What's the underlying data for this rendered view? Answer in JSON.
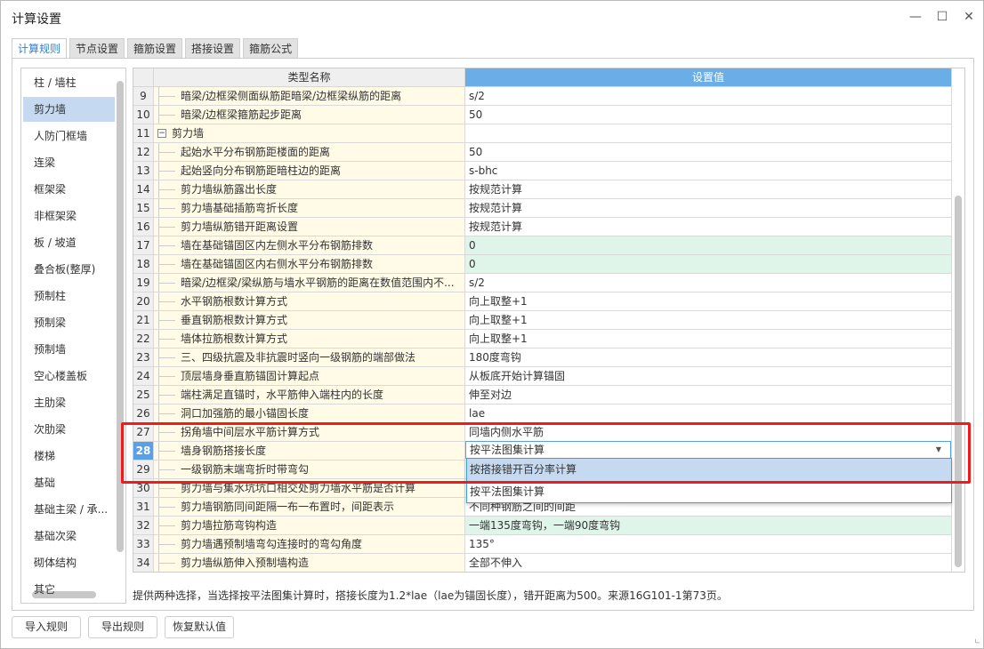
{
  "window": {
    "title": "计算设置",
    "minimize_icon": "minimize-icon",
    "maximize_icon": "maximize-icon",
    "close_icon": "close-icon"
  },
  "tabs": [
    {
      "label": "计算规则",
      "active": true
    },
    {
      "label": "节点设置"
    },
    {
      "label": "箍筋设置"
    },
    {
      "label": "搭接设置"
    },
    {
      "label": "箍筋公式"
    }
  ],
  "sidebar": {
    "selected": "剪力墙",
    "items": [
      "柱 / 墙柱",
      "剪力墙",
      "人防门框墙",
      "连梁",
      "框架梁",
      "非框架梁",
      "板 / 坡道",
      "叠合板(整厚)",
      "预制柱",
      "预制梁",
      "预制墙",
      "空心楼盖板",
      "主肋梁",
      "次肋梁",
      "楼梯",
      "基础",
      "基础主梁 / 承...",
      "基础次梁",
      "砌体结构",
      "其它"
    ]
  },
  "grid": {
    "headers": {
      "name": "类型名称",
      "value": "设置值"
    },
    "rows": [
      {
        "n": "9",
        "name": "暗梁/边框梁侧面纵筋距暗梁/边框梁纵筋的距离",
        "value": "s/2"
      },
      {
        "n": "10",
        "name": "暗梁/边框梁箍筋起步距离",
        "value": "50"
      },
      {
        "n": "11",
        "name": "剪力墙",
        "value": "",
        "group": true
      },
      {
        "n": "12",
        "name": "起始水平分布钢筋距楼面的距离",
        "value": "50"
      },
      {
        "n": "13",
        "name": "起始竖向分布钢筋距暗柱边的距离",
        "value": "s-bhc"
      },
      {
        "n": "14",
        "name": "剪力墙纵筋露出长度",
        "value": "按规范计算"
      },
      {
        "n": "15",
        "name": "剪力墙基础插筋弯折长度",
        "value": "按规范计算"
      },
      {
        "n": "16",
        "name": "剪力墙纵筋错开距离设置",
        "value": "按规范计算"
      },
      {
        "n": "17",
        "name": "墙在基础锚固区内左侧水平分布钢筋排数",
        "value": "0",
        "green": true
      },
      {
        "n": "18",
        "name": "墙在基础锚固区内右侧水平分布钢筋排数",
        "value": "0",
        "green": true
      },
      {
        "n": "19",
        "name": "暗梁/边框梁/梁纵筋与墙水平钢筋的距离在数值范围内不...",
        "value": "s/2"
      },
      {
        "n": "20",
        "name": "水平钢筋根数计算方式",
        "value": "向上取整+1"
      },
      {
        "n": "21",
        "name": "垂直钢筋根数计算方式",
        "value": "向上取整+1"
      },
      {
        "n": "22",
        "name": "墙体拉筋根数计算方式",
        "value": "向上取整+1"
      },
      {
        "n": "23",
        "name": "三、四级抗震及非抗震时竖向一级钢筋的端部做法",
        "value": "180度弯钩"
      },
      {
        "n": "24",
        "name": "顶层墙身垂直筋锚固计算起点",
        "value": "从板底开始计算锚固"
      },
      {
        "n": "25",
        "name": "端柱满足直锚时，水平筋伸入端柱内的长度",
        "value": "伸至对边"
      },
      {
        "n": "26",
        "name": "洞口加强筋的最小锚固长度",
        "value": "lae"
      },
      {
        "n": "27",
        "name": "拐角墙中间层水平筋计算方式",
        "value": "同墙内侧水平筋"
      },
      {
        "n": "28",
        "name": "墙身钢筋搭接长度",
        "value": "按平法图集计算",
        "selected": true
      },
      {
        "n": "29",
        "name": "一级钢筋末端弯折时带弯勾",
        "value": ""
      },
      {
        "n": "30",
        "name": "剪力墙与集水坑坑口相交处剪力墙水平筋是否计算",
        "value": ""
      },
      {
        "n": "31",
        "name": "剪力墙钢筋同间距隔一布一布置时，间距表示",
        "value": "不同种钢筋之间的间距"
      },
      {
        "n": "32",
        "name": "剪力墙拉筋弯钩构造",
        "value": "一端135度弯钩，一端90度弯钩",
        "green": true
      },
      {
        "n": "33",
        "name": "剪力墙遇预制墙弯勾连接时的弯勾角度",
        "value": "135°"
      },
      {
        "n": "34",
        "name": "剪力墙纵筋伸入预制墙构造",
        "value": "全部不伸入"
      }
    ]
  },
  "dropdown": {
    "current": "按平法图集计算",
    "options": [
      "按搭接错开百分率计算",
      "按平法图集计算"
    ],
    "highlighted": 0
  },
  "description": "提供两种选择，当选择按平法图集计算时，搭接长度为1.2*lae（lae为锚固长度），错开距离为500。来源16G101-1第73页。",
  "buttons": {
    "import": "导入规则",
    "export": "导出规则",
    "restore": "恢复默认值"
  },
  "colors": {
    "accent": "#2f80d0",
    "selection": "#c5daf0",
    "highlight_box": "#f01c1c",
    "name_cell": "#fffbe6",
    "green_cell": "#dff5ea"
  }
}
